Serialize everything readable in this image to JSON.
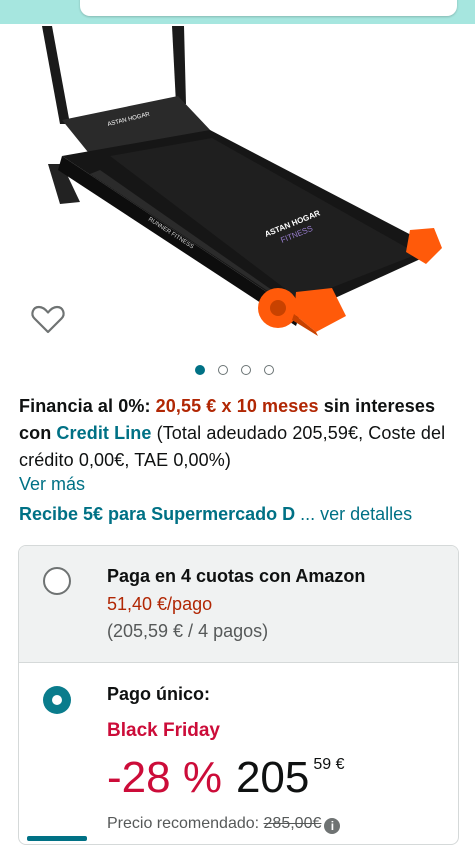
{
  "colors": {
    "accent_teal": "#007185",
    "price_red": "#b12704",
    "deal_red": "#cc0c39",
    "topbar": "#a6e6df",
    "treadmill_orange": "#ff5a0a"
  },
  "product": {
    "brand_logo_text": "ASTAN HOGAR",
    "brand_logo_sub": "FITNESS",
    "model_text": "RUNNER FITNESS",
    "wishlist_icon": "heart-outline-icon",
    "carousel": {
      "total": 4,
      "active_index": 0
    }
  },
  "financing": {
    "label": "Financia al 0%:",
    "installment": "20,55 € x 10 meses",
    "mid": " sin intereses con ",
    "provider": "Credit Line",
    "detail": " (Total adeudado 205,59€, Coste del crédito 0,00€, TAE 0,00%)",
    "more_link": "Ver más"
  },
  "promo": {
    "offer": "Recibe 5€ para Supermercado D",
    "details": " ... ver detalles"
  },
  "payment_options": {
    "installments": {
      "title": "Paga en 4 cuotas con Amazon",
      "per_payment": "51,40 €/pago",
      "summary": "(205,59 € / 4 pagos)",
      "selected": false
    },
    "single": {
      "title": "Pago único:",
      "badge": "Black Friday",
      "discount": "-28 %",
      "price_whole": "205",
      "price_fraction": "59 €",
      "rrp_label": "Precio recomendado: ",
      "rrp_value": "285,00€",
      "selected": true
    }
  }
}
